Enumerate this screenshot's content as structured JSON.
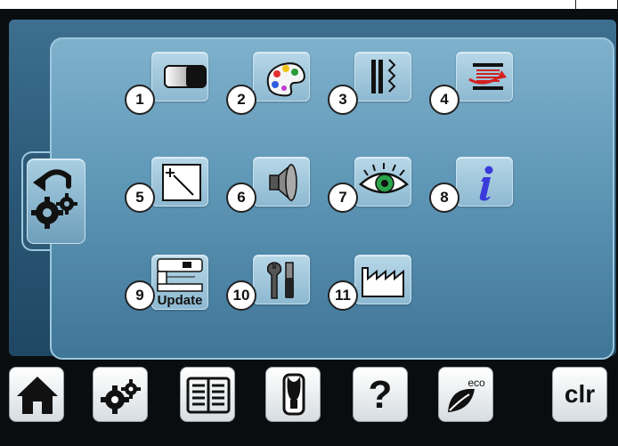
{
  "settings_tiles": [
    {
      "number": "1",
      "icon": "contrast-icon"
    },
    {
      "number": "2",
      "icon": "palette-icon"
    },
    {
      "number": "3",
      "icon": "stitch-width-icon"
    },
    {
      "number": "4",
      "icon": "bobbin-icon"
    },
    {
      "number": "5",
      "icon": "calibrate-pen-icon"
    },
    {
      "number": "6",
      "icon": "speaker-icon"
    },
    {
      "number": "7",
      "icon": "eye-icon"
    },
    {
      "number": "8",
      "icon": "info-icon"
    },
    {
      "number": "9",
      "icon": "sewing-machine-update-icon",
      "label": "Update"
    },
    {
      "number": "10",
      "icon": "service-tools-icon"
    },
    {
      "number": "11",
      "icon": "factory-icon"
    }
  ],
  "toolbar": {
    "home": "home-icon",
    "setup": "gears-icon",
    "tutorial": "book-icon",
    "sewing_consultant": "dress-form-icon",
    "help_label": "?",
    "eco_label": "eco",
    "clear_label": "clr"
  },
  "colors": {
    "panel": "#2a5675",
    "inner": "#6fa3c2",
    "tile": "#a3c9dd",
    "info_blue": "#3a3adb",
    "eye_green": "#2aa34a",
    "bobbin_red": "#d42020"
  }
}
